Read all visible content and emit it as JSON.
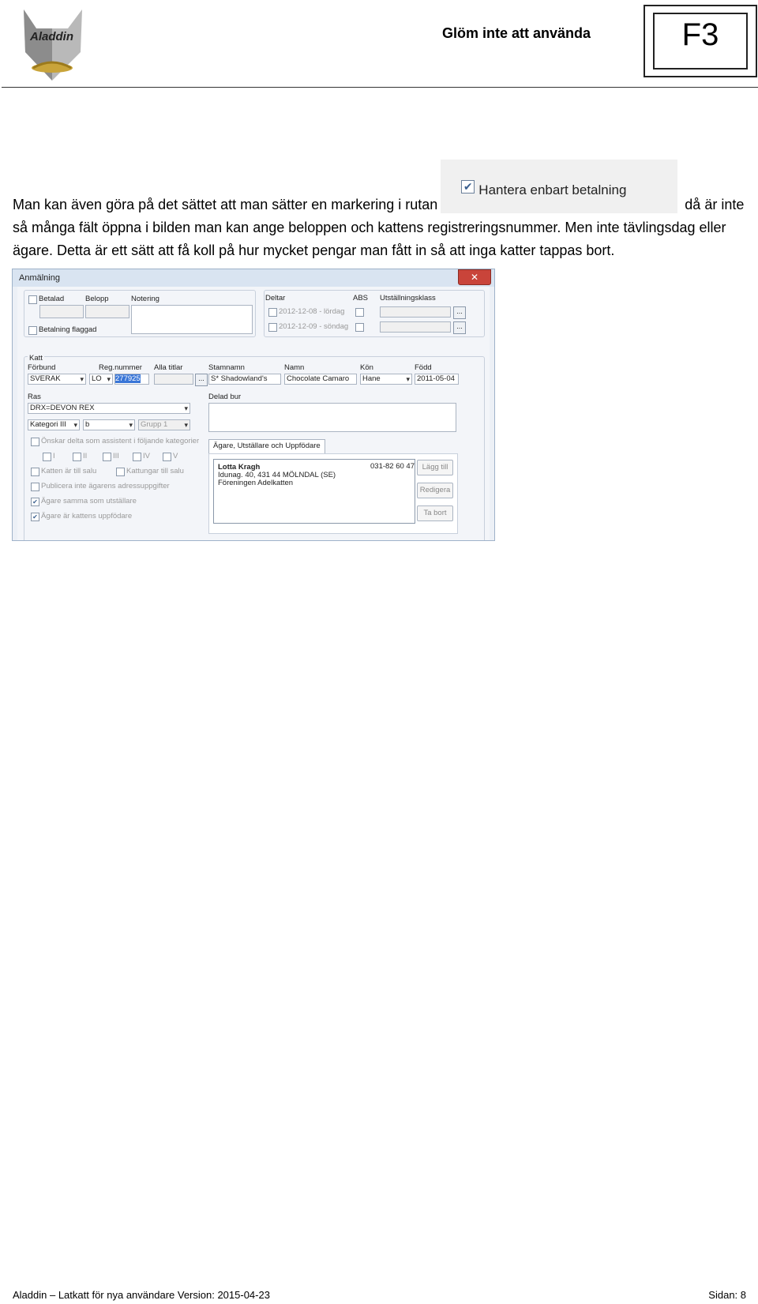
{
  "header": {
    "logo_text": "Aladdin",
    "title": "Glöm inte att använda",
    "key_label": "F3"
  },
  "body": {
    "part1": "Man kan även göra på det sättet att man sätter en markering i rutan",
    "checkbox_label": "Hantera enbart betalning",
    "part2": " då är inte så många fält öppna i bilden man kan ange beloppen och kattens registreringsnummer. Men inte tävlingsdag eller ägare.  Detta är ett sätt att få koll på hur mycket pengar man fått in så att inga katter tappas bort."
  },
  "dialog": {
    "title": "Anmälning",
    "close": "✕",
    "betalad": "Betalad",
    "belopp": "Belopp",
    "notering": "Notering",
    "betalning_flaggad": "Betalning flaggad",
    "deltar": "Deltar",
    "abs": "ABS",
    "utstallningsklass": "Utställningsklass",
    "date1": "2012-12-08 - lördag",
    "date2": "2012-12-09 - söndag",
    "ellipsis": "...",
    "katt": "Katt",
    "forbund": "Förbund",
    "reg_nummer": "Reg.nummer",
    "alla_titlar": "Alla titlar",
    "stamnamn": "Stamnamn",
    "namn": "Namn",
    "kon": "Kön",
    "fodd": "Född",
    "forbund_val": "SVERAK",
    "reg_prefix": "LO",
    "reg_val": "277925",
    "stamnamn_val": "S* Shadowland's",
    "namn_val": "Chocolate Camaro",
    "kon_val": "Hane",
    "fodd_val": "2011-05-04",
    "ras": "Ras",
    "ras_val": "DRX=DEVON REX",
    "delad_bur": "Delad bur",
    "kategori_val": "Kategori III",
    "farg_val": "b",
    "grupp_val": "Grupp 1",
    "onskar": "Önskar delta som assistent i följande kategorier",
    "kat": [
      "I",
      "II",
      "III",
      "IV",
      "V"
    ],
    "katten_salu": "Katten är till salu",
    "kattungar_salu": "Kattungar till salu",
    "publicera": "Publicera inte ägarens adressuppgifter",
    "agare_samma": "Ägare samma som utställare",
    "agare_uppfodare": "Ägare är kattens uppfödare",
    "tab": "Ägare, Utställare och Uppfödare",
    "owner_name": "Lotta Kragh",
    "owner_phone": "031-82 60 47",
    "owner_addr": "Idunag. 40, 431 44 MÖLNDAL (SE)",
    "owner_club": "Föreningen Adelkatten",
    "lagg_till": "Lägg till",
    "redigera": "Redigera",
    "ta_bort": "Ta bort"
  },
  "footer": {
    "left": "Aladdin – Latkatt för nya användare Version: 2015-04-23",
    "right": "Sidan: 8"
  }
}
